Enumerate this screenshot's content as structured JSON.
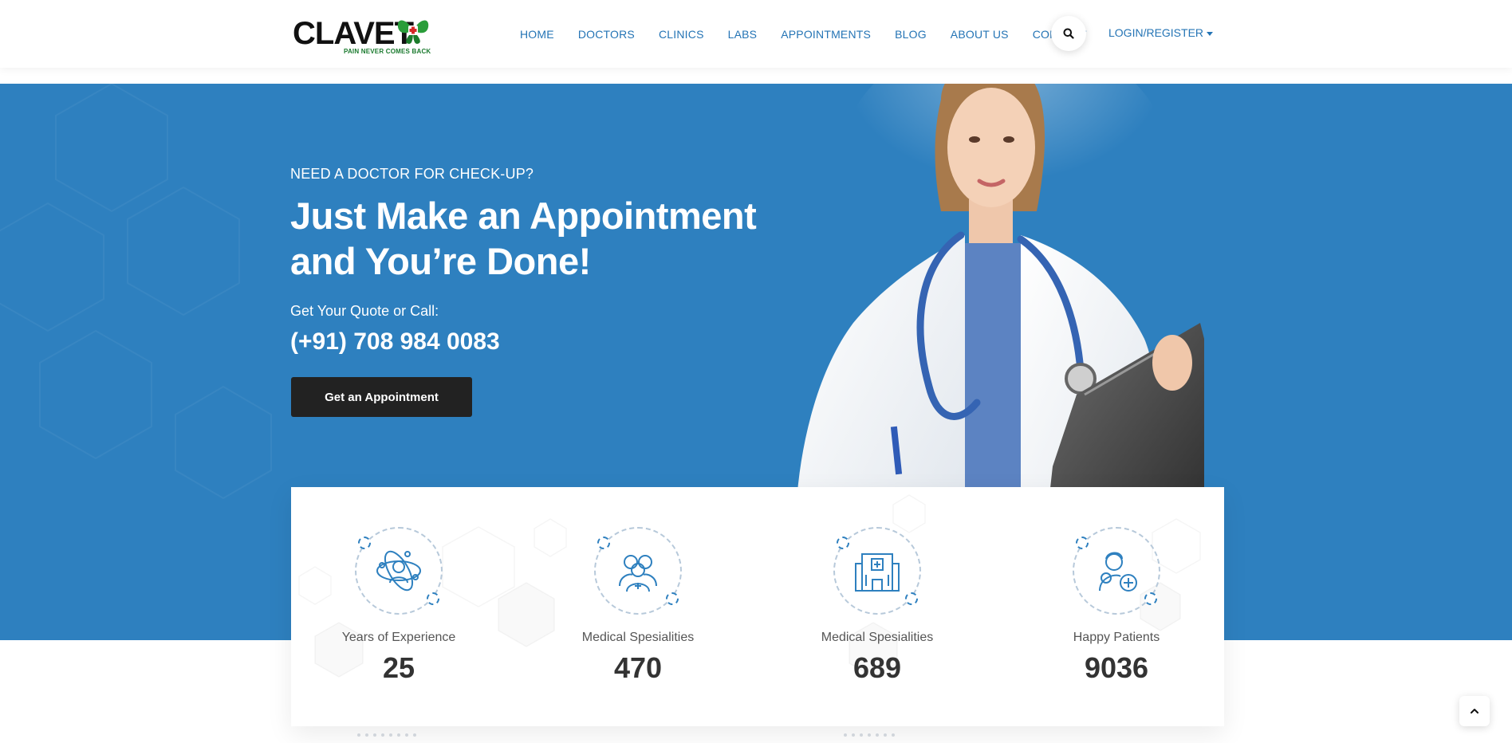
{
  "brand": {
    "name": "CLAVET",
    "tagline": "PAIN NEVER COMES BACK"
  },
  "nav": {
    "items": [
      "HOME",
      "DOCTORS",
      "CLINICS",
      "LABS",
      "APPOINTMENTS",
      "BLOG",
      "ABOUT US",
      "CONTACT"
    ],
    "search_icon": "search-icon",
    "login_label": "LOGIN/REGISTER"
  },
  "hero": {
    "eyebrow": "NEED A DOCTOR FOR CHECK-UP?",
    "title": "Just Make an Appointment and You’re Done!",
    "quote_text": "Get Your Quote or Call:",
    "phone": "(+91) 708 984 0083",
    "cta_label": "Get an Appointment"
  },
  "stats": [
    {
      "icon": "doctor-atom-icon",
      "label": "Years of Experience",
      "value": "25"
    },
    {
      "icon": "medical-team-icon",
      "label": "Medical Spesialities",
      "value": "470"
    },
    {
      "icon": "hospital-icon",
      "label": "Medical Spesialities",
      "value": "689"
    },
    {
      "icon": "happy-patient-icon",
      "label": "Happy Patients",
      "value": "9036"
    }
  ],
  "colors": {
    "primary": "#2e80bf",
    "nav_text": "#2474b5",
    "cta_bg": "#222222",
    "logo_green": "#1a7a2e"
  }
}
